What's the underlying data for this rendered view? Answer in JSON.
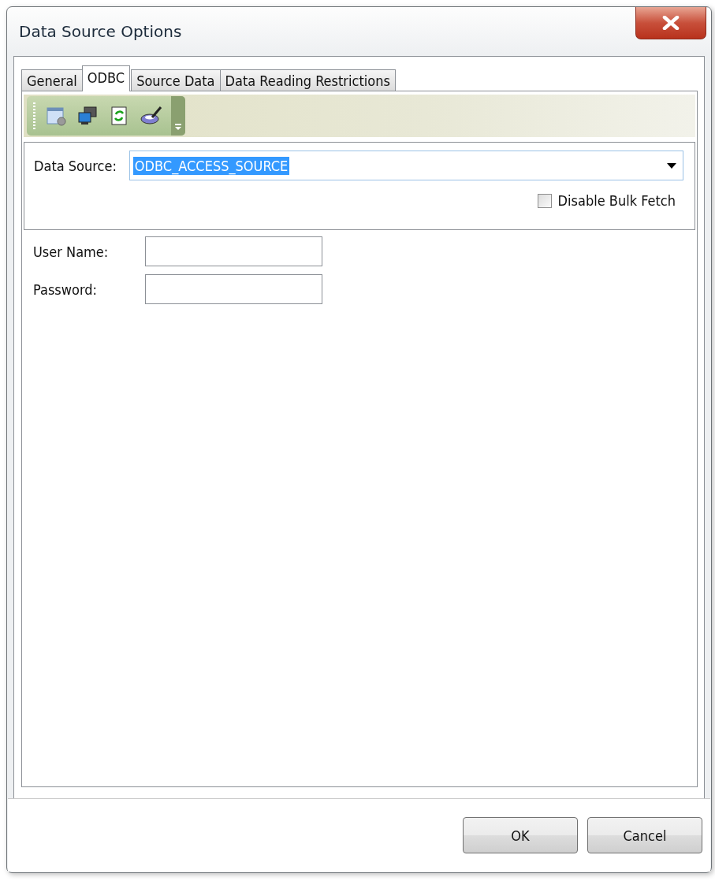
{
  "window": {
    "title": "Data Source Options"
  },
  "tabs": [
    {
      "label": "General",
      "selected": false
    },
    {
      "label": "ODBC",
      "selected": true
    },
    {
      "label": "Source Data",
      "selected": false
    },
    {
      "label": "Data Reading Restrictions",
      "selected": false
    }
  ],
  "data_source": {
    "label": "Data Source:",
    "value": "ODBC_ACCESS_SOURCE",
    "highlighted": true
  },
  "disable_bulk_fetch": {
    "label": "Disable Bulk Fetch",
    "checked": false
  },
  "fields": [
    {
      "label": "User Name:"
    },
    {
      "label": "Password:"
    }
  ],
  "buttons": [
    "OK",
    "Cancel"
  ]
}
